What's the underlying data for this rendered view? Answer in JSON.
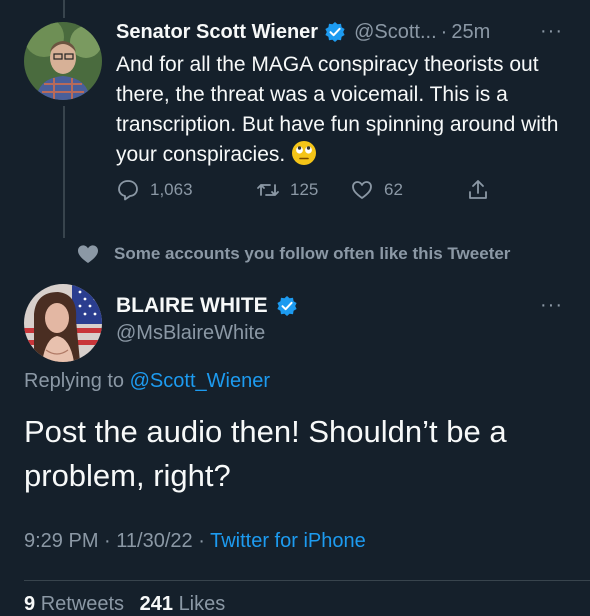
{
  "tweet1": {
    "author_name": "Senator Scott Wiener",
    "handle": "@Scott...",
    "separator": "·",
    "time": "25m",
    "more": "···",
    "text": "And for all the MAGA conspiracy theorists out there, the threat was a voicemail. This is a transcription. But have fun spinning around with your conspiracies.",
    "emoji_icon": "eye-roll-emoji",
    "replies": "1,063",
    "retweets": "125",
    "likes": "62"
  },
  "social_context": {
    "icon": "heart-icon",
    "text": "Some accounts you follow often like this Tweeter"
  },
  "tweet2": {
    "author_name": "BLAIRE WHITE",
    "handle": "@MsBlaireWhite",
    "more": "···",
    "replying_prefix": "Replying to",
    "replying_to": "@Scott_Wiener",
    "text": "Post the audio then! Shouldn’t be a problem, right?",
    "time": "9:29 PM",
    "date": "11/30/22",
    "source": "Twitter for iPhone",
    "dot": "·",
    "retweets_count": "9",
    "retweets_label": "Retweets",
    "likes_count": "241",
    "likes_label": "Likes"
  },
  "colors": {
    "background": "#15202b",
    "text": "#f7f9f9",
    "muted": "#8b98a5",
    "link": "#1d9bf0",
    "verified": "#1d9bf0"
  }
}
